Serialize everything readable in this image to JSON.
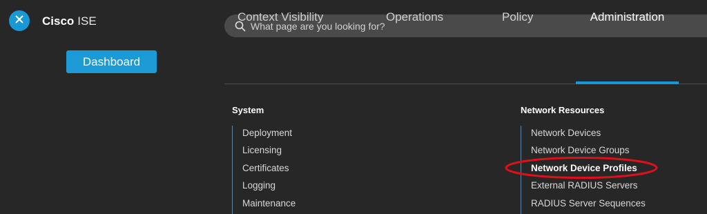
{
  "header": {
    "brand_primary": "Cisco",
    "brand_secondary": "ISE",
    "dashboard_label": "Dashboard"
  },
  "search": {
    "placeholder": "What page are you looking for?",
    "value": ""
  },
  "tabs": [
    {
      "label": "Context Visibility"
    },
    {
      "label": "Operations"
    },
    {
      "label": "Policy"
    },
    {
      "label": "Administration",
      "active": true
    }
  ],
  "sections": {
    "system": {
      "title": "System",
      "items": [
        "Deployment",
        "Licensing",
        "Certificates",
        "Logging",
        "Maintenance"
      ]
    },
    "network_resources": {
      "title": "Network Resources",
      "items": [
        "Network Devices",
        "Network Device Groups",
        "Network Device Profiles",
        "External RADIUS Servers",
        "RADIUS Server Sequences"
      ],
      "highlighted": "Network Device Profiles"
    }
  },
  "colors": {
    "accent": "#1a98d6",
    "background": "#272727",
    "highlight_annotation": "#e0101a"
  },
  "icons": {
    "close": "close-icon",
    "search": "search-icon"
  }
}
